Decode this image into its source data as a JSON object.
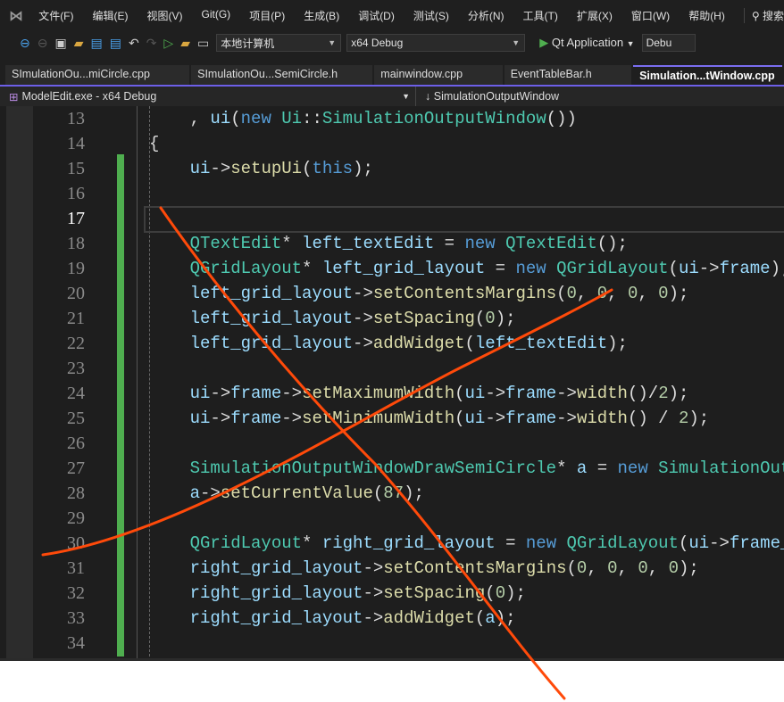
{
  "menu": [
    "文件(F)",
    "编辑(E)",
    "视图(V)",
    "Git(G)",
    "项目(P)",
    "生成(B)",
    "调试(D)",
    "测试(S)",
    "分析(N)",
    "工具(T)",
    "扩展(X)",
    "窗口(W)",
    "帮助(H)"
  ],
  "search_label": "搜索",
  "toolbar": {
    "target": "本地计算机",
    "config": "x64 Debug",
    "run_label": "Qt Application",
    "config2": "Debu"
  },
  "tabs": [
    "SImulationOu...miCircle.cpp",
    "SImulationOu...SemiCircle.h",
    "mainwindow.cpp",
    "EventTableBar.h",
    "Simulation...tWindow.cpp"
  ],
  "active_tab": 4,
  "navbar": {
    "project": "ModelEdit.exe - x64 Debug",
    "scope": "SimulationOutputWindow"
  },
  "current_line": 17,
  "lines": [
    {
      "n": "13",
      "t": [
        [
          "    , ",
          "op"
        ],
        [
          "ui",
          "var"
        ],
        [
          "(",
          "op"
        ],
        [
          "new ",
          "kw"
        ],
        [
          "Ui",
          "ty"
        ],
        [
          "::",
          "op"
        ],
        [
          "SimulationOutputWindow",
          "ty"
        ],
        [
          "())",
          "op"
        ]
      ]
    },
    {
      "n": "14",
      "t": [
        [
          "{",
          "op"
        ]
      ]
    },
    {
      "n": "15",
      "t": [
        [
          "    ",
          "op"
        ],
        [
          "ui",
          "var"
        ],
        [
          "->",
          "op"
        ],
        [
          "setupUi",
          "fn"
        ],
        [
          "(",
          "op"
        ],
        [
          "this",
          "kw"
        ],
        [
          ");",
          "op"
        ]
      ]
    },
    {
      "n": "16",
      "t": []
    },
    {
      "n": "17",
      "t": []
    },
    {
      "n": "18",
      "t": [
        [
          "    ",
          "op"
        ],
        [
          "QTextEdit",
          "ty"
        ],
        [
          "* ",
          "op"
        ],
        [
          "left_textEdit",
          "var"
        ],
        [
          " = ",
          "op"
        ],
        [
          "new ",
          "kw"
        ],
        [
          "QTextEdit",
          "ty"
        ],
        [
          "();",
          "op"
        ]
      ]
    },
    {
      "n": "19",
      "t": [
        [
          "    ",
          "op"
        ],
        [
          "QGridLayout",
          "ty"
        ],
        [
          "* ",
          "op"
        ],
        [
          "left_grid_layout",
          "var"
        ],
        [
          " = ",
          "op"
        ],
        [
          "new ",
          "kw"
        ],
        [
          "QGridLayout",
          "ty"
        ],
        [
          "(",
          "op"
        ],
        [
          "ui",
          "var"
        ],
        [
          "->",
          "op"
        ],
        [
          "frame",
          "var"
        ],
        [
          ");",
          "op"
        ]
      ]
    },
    {
      "n": "20",
      "t": [
        [
          "    ",
          "op"
        ],
        [
          "left_grid_layout",
          "var"
        ],
        [
          "->",
          "op"
        ],
        [
          "setContentsMargins",
          "fn"
        ],
        [
          "(",
          "op"
        ],
        [
          "0",
          "num"
        ],
        [
          ", ",
          "op"
        ],
        [
          "0",
          "num"
        ],
        [
          ", ",
          "op"
        ],
        [
          "0",
          "num"
        ],
        [
          ", ",
          "op"
        ],
        [
          "0",
          "num"
        ],
        [
          ");",
          "op"
        ]
      ]
    },
    {
      "n": "21",
      "t": [
        [
          "    ",
          "op"
        ],
        [
          "left_grid_layout",
          "var"
        ],
        [
          "->",
          "op"
        ],
        [
          "setSpacing",
          "fn"
        ],
        [
          "(",
          "op"
        ],
        [
          "0",
          "num"
        ],
        [
          ");",
          "op"
        ]
      ]
    },
    {
      "n": "22",
      "t": [
        [
          "    ",
          "op"
        ],
        [
          "left_grid_layout",
          "var"
        ],
        [
          "->",
          "op"
        ],
        [
          "addWidget",
          "fn"
        ],
        [
          "(",
          "op"
        ],
        [
          "left_textEdit",
          "var"
        ],
        [
          ");",
          "op"
        ]
      ]
    },
    {
      "n": "23",
      "t": []
    },
    {
      "n": "24",
      "t": [
        [
          "    ",
          "op"
        ],
        [
          "ui",
          "var"
        ],
        [
          "->",
          "op"
        ],
        [
          "frame",
          "var"
        ],
        [
          "->",
          "op"
        ],
        [
          "setMaximumWidth",
          "fn"
        ],
        [
          "(",
          "op"
        ],
        [
          "ui",
          "var"
        ],
        [
          "->",
          "op"
        ],
        [
          "frame",
          "var"
        ],
        [
          "->",
          "op"
        ],
        [
          "width",
          "fn"
        ],
        [
          "()/",
          "op"
        ],
        [
          "2",
          "num"
        ],
        [
          ");",
          "op"
        ]
      ]
    },
    {
      "n": "25",
      "t": [
        [
          "    ",
          "op"
        ],
        [
          "ui",
          "var"
        ],
        [
          "->",
          "op"
        ],
        [
          "frame",
          "var"
        ],
        [
          "->",
          "op"
        ],
        [
          "setMinimumWidth",
          "fn"
        ],
        [
          "(",
          "op"
        ],
        [
          "ui",
          "var"
        ],
        [
          "->",
          "op"
        ],
        [
          "frame",
          "var"
        ],
        [
          "->",
          "op"
        ],
        [
          "width",
          "fn"
        ],
        [
          "() / ",
          "op"
        ],
        [
          "2",
          "num"
        ],
        [
          ");",
          "op"
        ]
      ]
    },
    {
      "n": "26",
      "t": []
    },
    {
      "n": "27",
      "t": [
        [
          "    ",
          "op"
        ],
        [
          "SimulationOutputWindowDrawSemiCircle",
          "ty"
        ],
        [
          "* ",
          "op"
        ],
        [
          "a",
          "var"
        ],
        [
          " = ",
          "op"
        ],
        [
          "new ",
          "kw"
        ],
        [
          "SimulationOut",
          "ty"
        ]
      ]
    },
    {
      "n": "28",
      "t": [
        [
          "    ",
          "op"
        ],
        [
          "a",
          "var"
        ],
        [
          "->",
          "op"
        ],
        [
          "setCurrentValue",
          "fn"
        ],
        [
          "(",
          "op"
        ],
        [
          "87",
          "num"
        ],
        [
          ");",
          "op"
        ]
      ]
    },
    {
      "n": "29",
      "t": []
    },
    {
      "n": "30",
      "t": [
        [
          "    ",
          "op"
        ],
        [
          "QGridLayout",
          "ty"
        ],
        [
          "* ",
          "op"
        ],
        [
          "right_grid_layout",
          "var"
        ],
        [
          " = ",
          "op"
        ],
        [
          "new ",
          "kw"
        ],
        [
          "QGridLayout",
          "ty"
        ],
        [
          "(",
          "op"
        ],
        [
          "ui",
          "var"
        ],
        [
          "->",
          "op"
        ],
        [
          "frame_",
          "var"
        ]
      ]
    },
    {
      "n": "31",
      "t": [
        [
          "    ",
          "op"
        ],
        [
          "right_grid_layout",
          "var"
        ],
        [
          "->",
          "op"
        ],
        [
          "setContentsMargins",
          "fn"
        ],
        [
          "(",
          "op"
        ],
        [
          "0",
          "num"
        ],
        [
          ", ",
          "op"
        ],
        [
          "0",
          "num"
        ],
        [
          ", ",
          "op"
        ],
        [
          "0",
          "num"
        ],
        [
          ", ",
          "op"
        ],
        [
          "0",
          "num"
        ],
        [
          ");",
          "op"
        ]
      ]
    },
    {
      "n": "32",
      "t": [
        [
          "    ",
          "op"
        ],
        [
          "right_grid_layout",
          "var"
        ],
        [
          "->",
          "op"
        ],
        [
          "setSpacing",
          "fn"
        ],
        [
          "(",
          "op"
        ],
        [
          "0",
          "num"
        ],
        [
          ");",
          "op"
        ]
      ]
    },
    {
      "n": "33",
      "t": [
        [
          "    ",
          "op"
        ],
        [
          "right_grid_layout",
          "var"
        ],
        [
          "->",
          "op"
        ],
        [
          "addWidget",
          "fn"
        ],
        [
          "(",
          "op"
        ],
        [
          "a",
          "var"
        ],
        [
          ");",
          "op"
        ]
      ]
    },
    {
      "n": "34",
      "t": []
    }
  ],
  "colors": {
    "annotation": "#ff4a0a",
    "change_bar": "#4fae4f",
    "tab_accent": "#6d5fe8"
  }
}
